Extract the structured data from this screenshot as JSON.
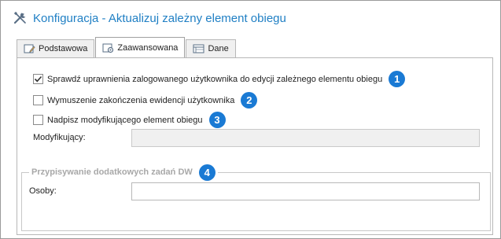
{
  "window": {
    "title": "Konfiguracja - Aktualizuj zależny element obiegu",
    "title_icon": "tools-icon",
    "accent_color": "#1f7fc4"
  },
  "tabs": [
    {
      "label": "Podstawowa",
      "icon": "edit-form-icon",
      "active": false
    },
    {
      "label": "Zaawansowana",
      "icon": "advanced-settings-icon",
      "active": true
    },
    {
      "label": "Dane",
      "icon": "data-table-icon",
      "active": false
    }
  ],
  "advanced": {
    "check_permissions": {
      "label": "Sprawdź uprawnienia zalogowanego użytkownika do edycji zależnego elementu obiegu",
      "checked": true,
      "badge": "1"
    },
    "force_end_tracking": {
      "label": "Wymuszenie zakończenia ewidencji użytkownika",
      "checked": false,
      "badge": "2"
    },
    "override_modifier": {
      "label": "Nadpisz modyfikującego element obiegu",
      "checked": false,
      "badge": "3"
    },
    "modifier_field": {
      "label": "Modyfikujący:",
      "value": "",
      "disabled": true
    },
    "tasks_group": {
      "title": "Przypisywanie dodatkowych zadań DW",
      "badge": "4",
      "persons_label": "Osoby:",
      "persons_value": ""
    }
  },
  "badge_color": "#1a7ad4"
}
